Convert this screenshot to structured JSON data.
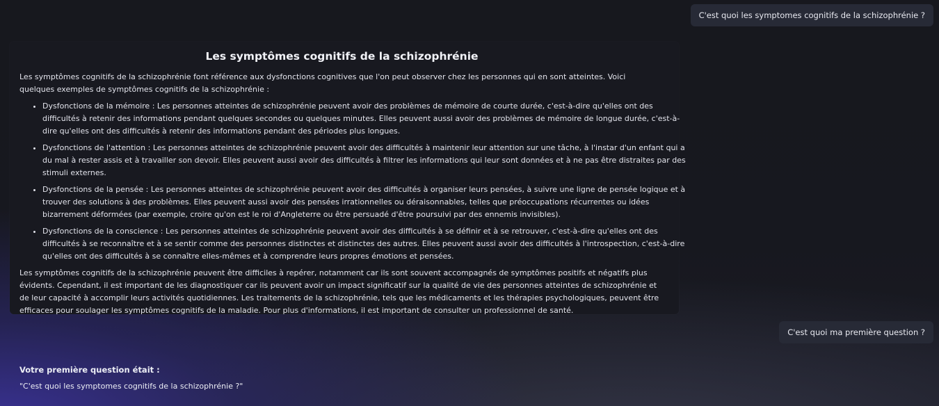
{
  "conversation": {
    "user_question_1": "C'est quoi les symptomes cognitifs de la schizophrénie ?",
    "answer_1": {
      "title": "Les symptômes cognitifs de la schizophrénie",
      "intro": "Les symptômes cognitifs de la schizophrénie font référence aux dysfonctions cognitives que l'on peut observer chez les personnes qui en sont atteintes. Voici quelques exemples de symptômes cognitifs de la schizophrénie :",
      "items": [
        "Dysfonctions de la mémoire : Les personnes atteintes de schizophrénie peuvent avoir des problèmes de mémoire de courte durée, c'est-à-dire qu'elles ont des difficultés à retenir des informations pendant quelques secondes ou quelques minutes. Elles peuvent aussi avoir des problèmes de mémoire de longue durée, c'est-à-dire qu'elles ont des difficultés à retenir des informations pendant des périodes plus longues.",
        "Dysfonctions de l'attention : Les personnes atteintes de schizophrénie peuvent avoir des difficultés à maintenir leur attention sur une tâche, à l'instar d'un enfant qui a du mal à rester assis et à travailler son devoir. Elles peuvent aussi avoir des difficultés à filtrer les informations qui leur sont données et à ne pas être distraites par des stimuli externes.",
        "Dysfonctions de la pensée : Les personnes atteintes de schizophrénie peuvent avoir des difficultés à organiser leurs pensées, à suivre une ligne de pensée logique et à trouver des solutions à des problèmes. Elles peuvent aussi avoir des pensées irrationnelles ou déraisonnables, telles que préoccupations récurrentes ou idées bizarrement déformées (par exemple, croire qu'on est le roi d'Angleterre ou être persuadé d'être poursuivi par des ennemis invisibles).",
        "Dysfonctions de la conscience : Les personnes atteintes de schizophrénie peuvent avoir des difficultés à se définir et à se retrouver, c'est-à-dire qu'elles ont des difficultés à se reconnaître et à se sentir comme des personnes distinctes et distinctes des autres. Elles peuvent aussi avoir des difficultés à l'introspection, c'est-à-dire qu'elles ont des difficultés à se connaître elles-mêmes et à comprendre leurs propres émotions et pensées."
      ],
      "outro": "Les symptômes cognitifs de la schizophrénie peuvent être difficiles à repérer, notamment car ils sont souvent accompagnés de symptômes positifs et négatifs plus évidents. Cependant, il est important de les diagnostiquer car ils peuvent avoir un impact significatif sur la qualité de vie des personnes atteintes de schizophrénie et de leur capacité à accomplir leurs activités quotidiennes. Les traitements de la schizophrénie, tels que les médicaments et les thérapies psychologiques, peuvent être efficaces pour soulager les symptômes cognitifs de la maladie. Pour plus d'informations, il est important de consulter un professionnel de santé."
    },
    "user_question_2": "C'est quoi ma première question ?",
    "answer_2": {
      "heading": "Votre première question était :",
      "quote": "\"C'est quoi les symptomes cognitifs de la schizophrénie ?\""
    }
  },
  "colors": {
    "background": "#17181e",
    "user_bubble": "#272a36",
    "answer_card": "#181920",
    "accent_glow": "#3a3296",
    "text": "#e3e4ec"
  }
}
